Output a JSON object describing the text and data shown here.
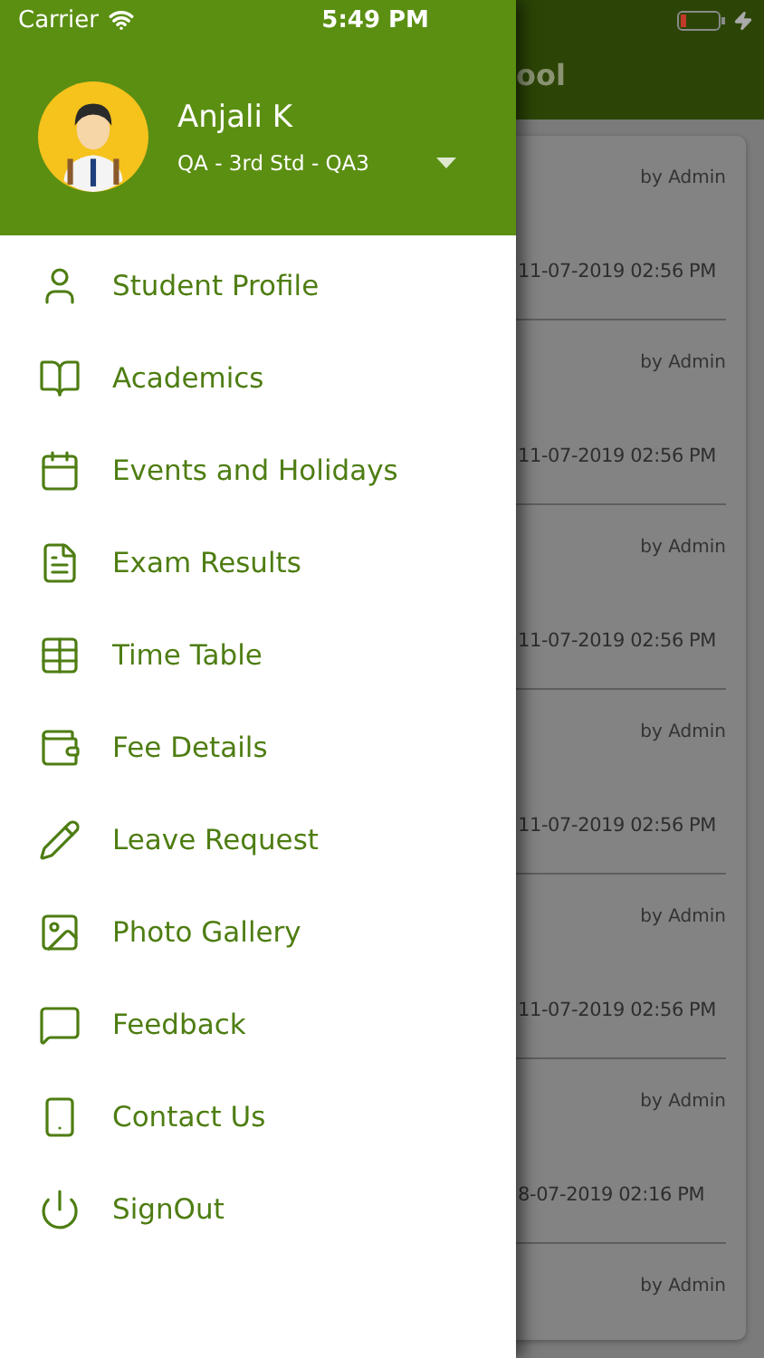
{
  "status_bar": {
    "carrier": "Carrier",
    "time": "5:49 PM"
  },
  "drawer": {
    "user": {
      "name": "Anjali K",
      "class": "QA - 3rd Std - QA3"
    },
    "items": [
      {
        "label": "Student Profile"
      },
      {
        "label": "Academics"
      },
      {
        "label": "Events and Holidays"
      },
      {
        "label": "Exam Results"
      },
      {
        "label": "Time Table"
      },
      {
        "label": "Fee Details"
      },
      {
        "label": "Leave Request"
      },
      {
        "label": "Photo Gallery"
      },
      {
        "label": "Feedback"
      },
      {
        "label": "Contact Us"
      },
      {
        "label": "SignOut"
      }
    ]
  },
  "background": {
    "title": "ool",
    "posts": [
      {
        "author": "by Admin",
        "date": "11-07-2019 02:56 PM"
      },
      {
        "author": "by Admin",
        "date": "11-07-2019 02:56 PM"
      },
      {
        "author": "by Admin",
        "date": "11-07-2019 02:56 PM"
      },
      {
        "author": "by Admin",
        "date": "11-07-2019 02:56 PM"
      },
      {
        "author": "by Admin",
        "date": "11-07-2019 02:56 PM"
      },
      {
        "author": "by Admin",
        "date": "8-07-2019 02:16 PM"
      },
      {
        "author": "by Admin"
      }
    ]
  }
}
